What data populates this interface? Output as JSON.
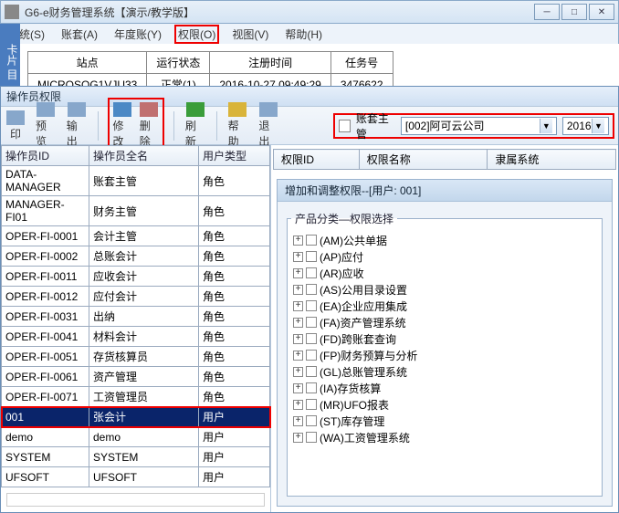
{
  "window": {
    "title": "G6-e财务管理系统【演示/教学版】"
  },
  "menu": {
    "system": "系统(S)",
    "account": "账套(A)",
    "year": "年度账(Y)",
    "permission": "权限(O)",
    "view": "视图(V)",
    "help": "帮助(H)"
  },
  "sidebar_stub": "卡片 目",
  "info": {
    "headers": {
      "site": "站点",
      "status": "运行状态",
      "regtime": "注册时间",
      "taskno": "任务号"
    },
    "row": {
      "site": "MICROSOG1VJU33",
      "status": "正常(1)",
      "regtime": "2016-10-27 09:49:29",
      "taskno": "3476622"
    }
  },
  "subwin_title": "操作员权限",
  "toolbar": {
    "print": "印",
    "preview": "预览",
    "output": "输出",
    "modify": "修改",
    "delete": "删除",
    "refresh": "刷新",
    "help": "帮助",
    "exit": "退出"
  },
  "filter": {
    "label": "账套主管",
    "company": "[002]阿可云公司",
    "year": "2016"
  },
  "opgrid": {
    "headers": {
      "id": "操作员ID",
      "name": "操作员全名",
      "type": "用户类型"
    },
    "rows": [
      {
        "id": "DATA-MANAGER",
        "name": "账套主管",
        "type": "角色"
      },
      {
        "id": "MANAGER-FI01",
        "name": "财务主管",
        "type": "角色"
      },
      {
        "id": "OPER-FI-0001",
        "name": "会计主管",
        "type": "角色"
      },
      {
        "id": "OPER-FI-0002",
        "name": "总账会计",
        "type": "角色"
      },
      {
        "id": "OPER-FI-0011",
        "name": "应收会计",
        "type": "角色"
      },
      {
        "id": "OPER-FI-0012",
        "name": "应付会计",
        "type": "角色"
      },
      {
        "id": "OPER-FI-0031",
        "name": "出纳",
        "type": "角色"
      },
      {
        "id": "OPER-FI-0041",
        "name": "材料会计",
        "type": "角色"
      },
      {
        "id": "OPER-FI-0051",
        "name": "存货核算员",
        "type": "角色"
      },
      {
        "id": "OPER-FI-0061",
        "name": "资产管理",
        "type": "角色"
      },
      {
        "id": "OPER-FI-0071",
        "name": "工资管理员",
        "type": "角色"
      },
      {
        "id": "001",
        "name": "张会计",
        "type": "用户",
        "selected": true,
        "redbox": true
      },
      {
        "id": "demo",
        "name": "demo",
        "type": "用户"
      },
      {
        "id": "SYSTEM",
        "name": "SYSTEM",
        "type": "用户"
      },
      {
        "id": "UFSOFT",
        "name": "UFSOFT",
        "type": "用户"
      }
    ]
  },
  "perm_headers": {
    "id": "权限ID",
    "name": "权限名称",
    "sys": "隶属系统"
  },
  "perm_panel_title": "增加和调整权限--[用户: 001]",
  "legend": "产品分类—权限选择",
  "tree": [
    {
      "label": "(AM)公共单据"
    },
    {
      "label": "(AP)应付"
    },
    {
      "label": "(AR)应收"
    },
    {
      "label": "(AS)公用目录设置"
    },
    {
      "label": "(EA)企业应用集成"
    },
    {
      "label": "(FA)资产管理系统"
    },
    {
      "label": "(FD)跨账套查询"
    },
    {
      "label": "(FP)财务预算与分析"
    },
    {
      "label": "(GL)总账管理系统"
    },
    {
      "label": "(IA)存货核算"
    },
    {
      "label": "(MR)UFO报表"
    },
    {
      "label": "(ST)库存管理"
    },
    {
      "label": "(WA)工资管理系统"
    }
  ]
}
